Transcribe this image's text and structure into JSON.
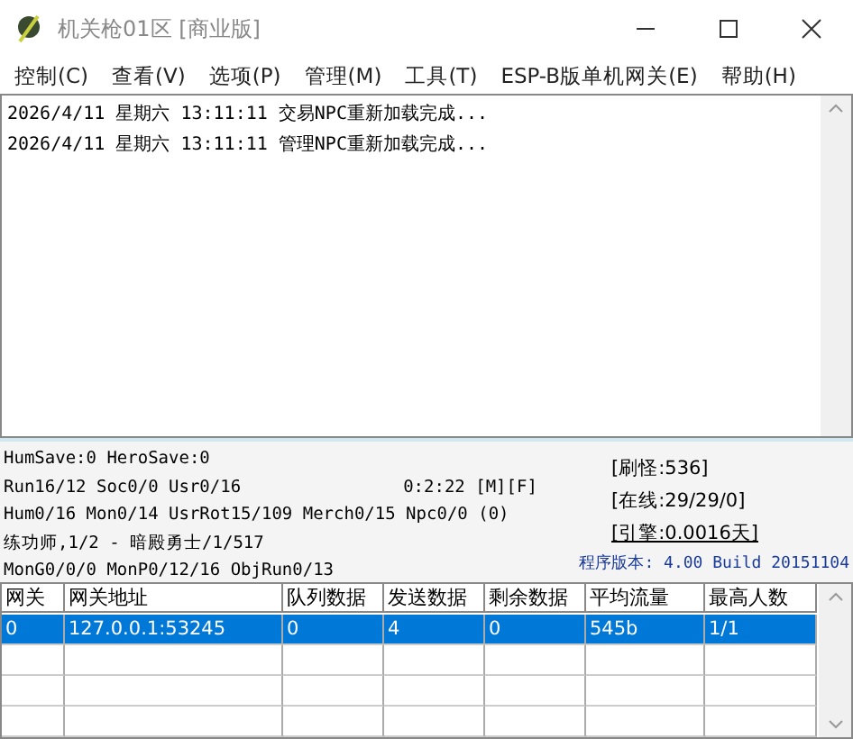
{
  "window": {
    "title": "机关枪01区 [商业版]"
  },
  "menu": [
    "控制(C)",
    "查看(V)",
    "选项(P)",
    "管理(M)",
    "工具(T)",
    "ESP-B版单机网关(E)",
    "帮助(H)"
  ],
  "log": [
    "2026/4/11 星期六 13:11:11 交易NPC重新加载完成...",
    "2026/4/11 星期六 13:11:11 管理NPC重新加载完成..."
  ],
  "status": {
    "left": [
      "HumSave:0 HeroSave:0",
      "Run16/12 Soc0/0 Usr0/16",
      "Hum0/16 Mon0/14 UsrRot15/109 Merch0/15 Npc0/0 (0)",
      "练功师,1/2 - 暗殿勇士/1/517",
      "MonG0/0/0 MonP0/12/16 ObjRun0/13"
    ],
    "uptime": "0:2:22 [M][F]",
    "right": [
      {
        "text": "[刷怪:536]",
        "underlined": false
      },
      {
        "text": "[在线:29/29/0]",
        "underlined": false
      },
      {
        "text": "[引擎:0.0016天]",
        "underlined": true
      }
    ],
    "version": "程序版本: 4.00 Build 20151104"
  },
  "table": {
    "columns": [
      "网关",
      "网关地址",
      "队列数据",
      "发送数据",
      "剩余数据",
      "平均流量",
      "最高人数"
    ],
    "rows": [
      {
        "selected": true,
        "cells": [
          "0",
          "127.0.0.1:53245",
          "0",
          "4",
          "0",
          "545b",
          "1/1"
        ]
      }
    ]
  }
}
